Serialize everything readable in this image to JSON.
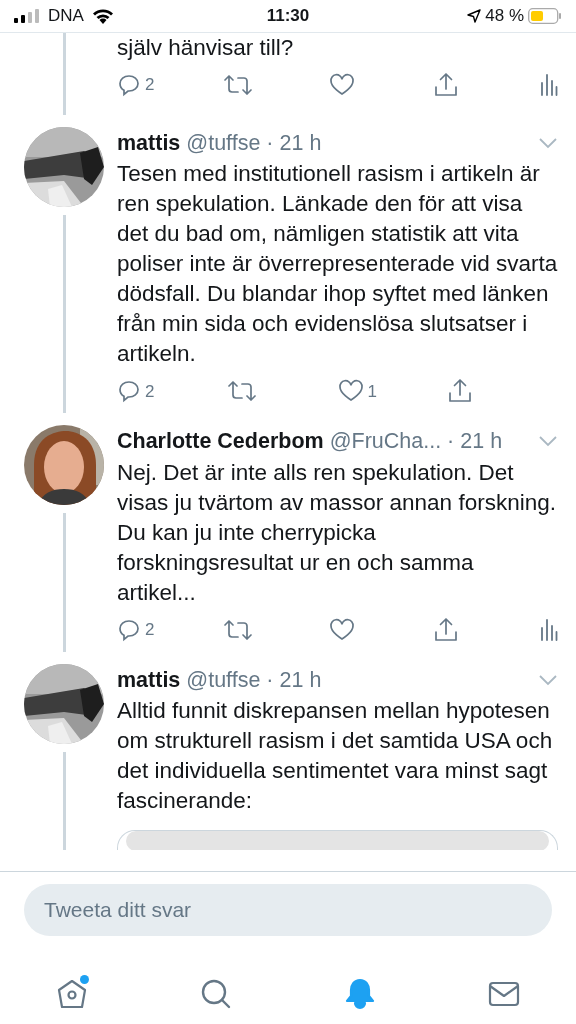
{
  "status_bar": {
    "carrier": "DNA",
    "time": "11:30",
    "battery": "48 %"
  },
  "tweets": [
    {
      "kind": "fragment",
      "text": "själv hänvisar till?",
      "replies": "2",
      "liked": false,
      "analytics": true
    },
    {
      "kind": "tweet",
      "name": "mattis",
      "handle": "@tuffse",
      "time": "· 21 h",
      "text": "Tesen med institutionell rasism i artikeln är ren spekulation. Länkade den för att visa det du bad om, nämligen statistik att vita poliser inte är överrepresenterade vid svarta dödsfall. Du blandar ihop syftet med länken från min sida och evidenslösa slutsatser  i artikeln.",
      "replies": "2",
      "likes": "1",
      "liked": false,
      "analytics": false
    },
    {
      "kind": "tweet",
      "name": "Charlotte Cederbom",
      "handle": "@FruCha...",
      "time": "· 21 h",
      "text": "Nej. Det är inte alls ren spekulation. Det visas ju tvärtom av massor annan forskning. Du kan ju inte cherrypicka forskningsresultat ur en och samma artikel...",
      "replies": "2",
      "liked": false,
      "analytics": true
    },
    {
      "kind": "media",
      "name": "mattis",
      "handle": "@tuffse",
      "time": "· 21 h",
      "text": "Alltid funnit diskrepansen mellan hypotesen om strukturell rasism i det samtida USA och det individuella sentimentet vara minst sagt fascinerande:"
    }
  ],
  "composer": {
    "placeholder": "Tweeta ditt svar"
  },
  "tabs": [
    {
      "kind": "home",
      "selected": false,
      "badge": true
    },
    {
      "kind": "search",
      "selected": false,
      "badge": false
    },
    {
      "kind": "notifications",
      "selected": true,
      "badge": false
    },
    {
      "kind": "messages",
      "selected": false,
      "badge": false
    }
  ]
}
